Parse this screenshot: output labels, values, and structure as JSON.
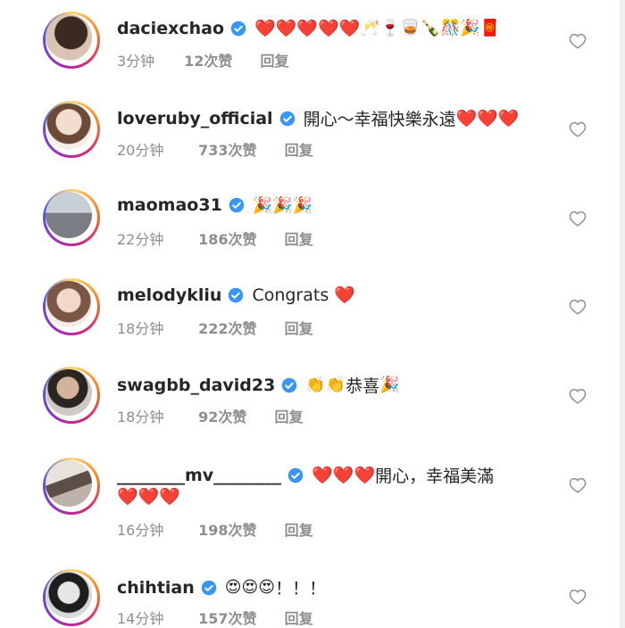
{
  "comments": [
    {
      "username": "daciexchao",
      "text": "",
      "hearts": "❤️❤️❤️❤️❤️",
      "emojis": "🥂🍷🥃🍾🎊🎉🧧",
      "time": "3分钟",
      "likes": "12次赞",
      "reply": "回复"
    },
    {
      "username": "loveruby_official",
      "text": "開心～幸福快樂永遠",
      "hearts": "❤️❤️❤️",
      "emojis": "",
      "time": "20分钟",
      "likes": "733次赞",
      "reply": "回复"
    },
    {
      "username": "maomao31",
      "text": "",
      "hearts": "",
      "emojis": "🎉🎉🎉",
      "time": "22分钟",
      "likes": "186次赞",
      "reply": "回复"
    },
    {
      "username": "melodykliu",
      "text": "Congrats",
      "hearts": "❤️",
      "emojis": "",
      "time": "18分钟",
      "likes": "222次赞",
      "reply": "回复"
    },
    {
      "username": "swagbb_david23",
      "text": "恭喜",
      "hearts": "",
      "emojis_before": "👏👏",
      "emojis": "🎉",
      "time": "18分钟",
      "likes": "92次赞",
      "reply": "回复"
    },
    {
      "username": "________mv________",
      "text": "開心，幸福美滿",
      "hearts": "❤️❤️❤️",
      "hearts_line2": "❤️❤️❤️",
      "emojis": "",
      "time": "16分钟",
      "likes": "198次赞",
      "reply": "回复"
    },
    {
      "username": "chihtian",
      "text": "！！！",
      "hearts": "",
      "emojis_before": "😍😍😍",
      "emojis": "",
      "time": "14分钟",
      "likes": "157次赞",
      "reply": "回复"
    }
  ],
  "icons": {
    "verified": "verified-badge-icon",
    "like": "heart-outline-icon"
  },
  "colors": {
    "verified": "#3897f0",
    "heart": "#d9202b",
    "meta": "#8e8e8e"
  }
}
